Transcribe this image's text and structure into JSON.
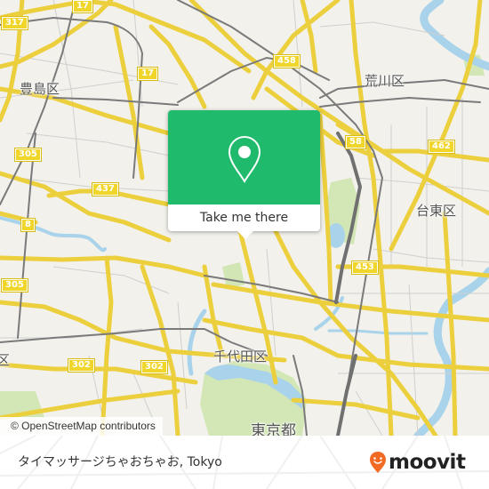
{
  "map": {
    "attribution": "© OpenStreetMap contributors",
    "districts": [
      {
        "id": "toshima",
        "label": "豊島区"
      },
      {
        "id": "arakawa",
        "label": "荒川区"
      },
      {
        "id": "taito",
        "label": "台東区"
      },
      {
        "id": "chiyoda",
        "label": "千代田区"
      },
      {
        "id": "tokyo",
        "label": "東京都"
      },
      {
        "id": "partial-ku",
        "label": "区"
      }
    ],
    "route_shields": [
      {
        "id": "r17a",
        "label": "17"
      },
      {
        "id": "r317",
        "label": "317"
      },
      {
        "id": "r17b",
        "label": "17"
      },
      {
        "id": "r458",
        "label": "458"
      },
      {
        "id": "r58",
        "label": "58"
      },
      {
        "id": "r462",
        "label": "462"
      },
      {
        "id": "r305a",
        "label": "305"
      },
      {
        "id": "r437",
        "label": "437"
      },
      {
        "id": "r8",
        "label": "8"
      },
      {
        "id": "r305b",
        "label": "305"
      },
      {
        "id": "r453",
        "label": "453"
      },
      {
        "id": "r302a",
        "label": "302"
      },
      {
        "id": "r302b",
        "label": "302"
      }
    ],
    "colors": {
      "land": "#f2f1ec",
      "major_road": "#f5df5a",
      "minor_road": "#c9c9c9",
      "rail": "#777777",
      "water": "#a9d3ea",
      "park": "#cfe5b0"
    }
  },
  "popup": {
    "icon": "location-pin-icon",
    "button_label": "Take me there",
    "accent_color": "#1fba6b"
  },
  "footer": {
    "place_name": "タイマッサージちゃおちゃお, Tokyo",
    "brand": "moovit",
    "brand_color": "#f26a24"
  }
}
